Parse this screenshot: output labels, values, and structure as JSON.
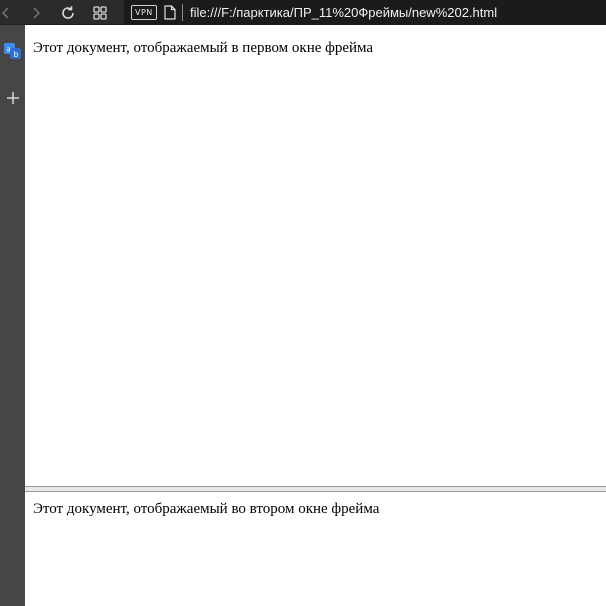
{
  "browser": {
    "nav": {
      "back_icon": "chevron-left-icon",
      "forward_icon": "chevron-right-icon",
      "reload_icon": "reload-icon",
      "tabs_icon": "grid-icon"
    },
    "address_bar": {
      "vpn_label": "VPN",
      "page_icon": "file-icon",
      "url": "file:///F:/парктика/ПР_11%20Фреймы/new%202.html"
    },
    "sidebar": {
      "items": [
        {
          "icon": "translate-icon"
        },
        {
          "icon": "plus-icon"
        }
      ]
    }
  },
  "frames": [
    {
      "text": "Этот документ, отображаемый в первом окне фрейма"
    },
    {
      "text": "Этот документ, отображаемый во втором окне фрейма"
    }
  ]
}
